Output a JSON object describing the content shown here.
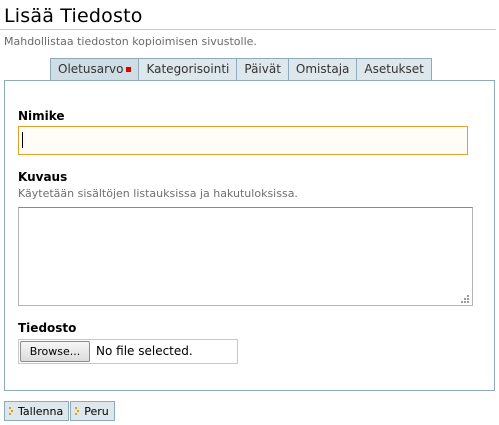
{
  "page": {
    "title": "Lisää Tiedosto",
    "description": "Mahdollistaa tiedoston kopioimisen sivustolle."
  },
  "tabs": [
    {
      "label": "Oletusarvo",
      "selected": true,
      "required_marker": true
    },
    {
      "label": "Kategorisointi",
      "selected": false
    },
    {
      "label": "Päivät",
      "selected": false
    },
    {
      "label": "Omistaja",
      "selected": false
    },
    {
      "label": "Asetukset",
      "selected": false
    }
  ],
  "form": {
    "title_field": {
      "label": "Nimike",
      "value": ""
    },
    "description_field": {
      "label": "Kuvaus",
      "help": "Käytetään sisältöjen listauksissa ja hakutuloksissa.",
      "value": ""
    },
    "file_field": {
      "label": "Tiedosto",
      "browse_label": "Browse...",
      "status": "No file selected."
    }
  },
  "actions": {
    "save_label": "Tallenna",
    "cancel_label": "Peru"
  },
  "colors": {
    "tab_background": "#dee7ec",
    "tab_border": "#8cacbb",
    "focus_border": "#e2a02a",
    "required_marker": "#e00000",
    "arrow_icon": "#e8a200"
  },
  "icons": {
    "required": "required-marker-icon",
    "save": "arrow-right-icon",
    "cancel": "arrow-right-icon",
    "resize": "resize-grip-icon"
  }
}
